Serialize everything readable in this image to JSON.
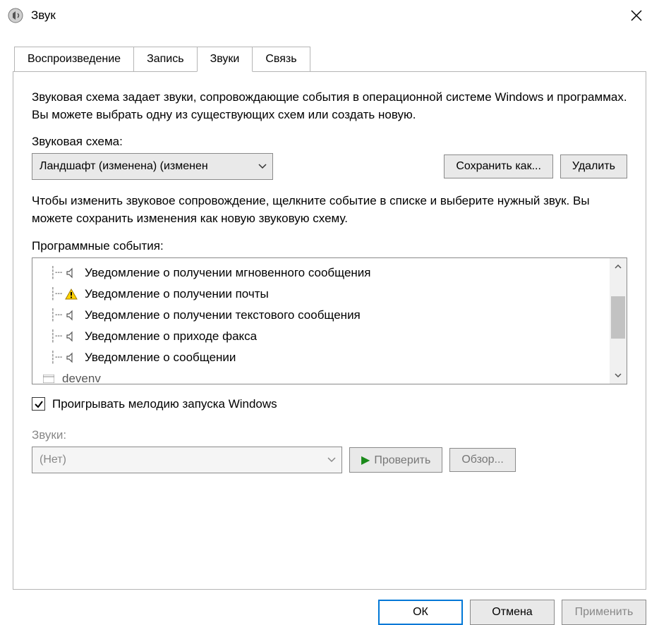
{
  "titlebar": {
    "title": "Звук"
  },
  "tabs": [
    {
      "label": "Воспроизведение"
    },
    {
      "label": "Запись"
    },
    {
      "label": "Звуки"
    },
    {
      "label": "Связь"
    }
  ],
  "desc1": "Звуковая схема задает звуки, сопровождающие события в операционной системе Windows и программах. Вы можете выбрать одну из существующих схем или создать новую.",
  "scheme_label": "Звуковая схема:",
  "scheme_value": "Ландшафт (изменена) (изменен",
  "btn_saveas": "Сохранить как...",
  "btn_delete": "Удалить",
  "desc2": "Чтобы изменить звуковое сопровождение, щелкните событие в списке и выберите нужный звук. Вы можете сохранить изменения как новую звуковую схему.",
  "events_label": "Программные события:",
  "events": [
    {
      "icon": "speaker",
      "label": "Уведомление о получении мгновенного сообщения"
    },
    {
      "icon": "warning",
      "label": "Уведомление о получении почты"
    },
    {
      "icon": "speaker",
      "label": "Уведомление о получении текстового сообщения"
    },
    {
      "icon": "speaker",
      "label": "Уведомление о приходе факса"
    },
    {
      "icon": "speaker",
      "label": "Уведомление о сообщении"
    }
  ],
  "events_partial": "devenv",
  "checkbox_label": "Проигрывать мелодию запуска Windows",
  "sounds_label": "Звуки:",
  "sounds_value": "(Нет)",
  "btn_test": "Проверить",
  "btn_browse": "Обзор...",
  "footer": {
    "ok": "ОК",
    "cancel": "Отмена",
    "apply": "Применить"
  }
}
